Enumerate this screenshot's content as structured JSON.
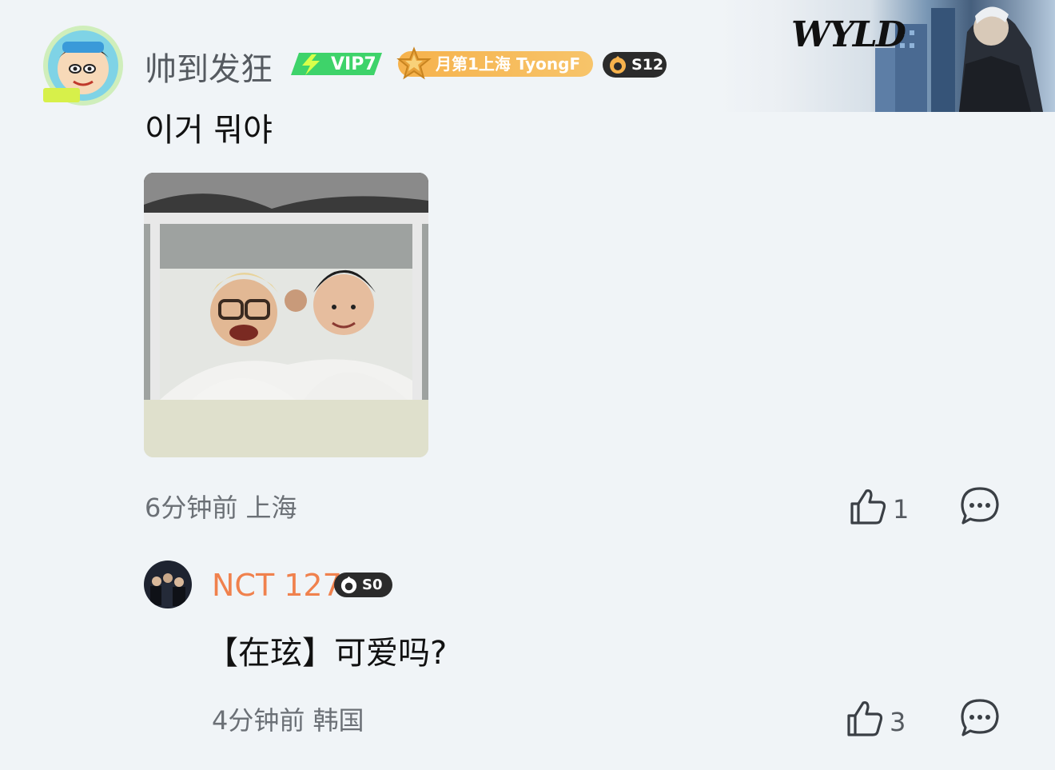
{
  "main_comment": {
    "username": "帅到发狂",
    "vip_badge": "VIP7",
    "rank_badge": "月第1上海 TyongF",
    "season_badge": "S12",
    "text": "이거 뭐야",
    "time": "6分钟前",
    "location": "上海",
    "like_count": "1"
  },
  "reply": {
    "username": "NCT 127",
    "season_badge": "S0",
    "text": "【在玹】可爱吗?",
    "time": "4分钟前",
    "location": "韩国",
    "like_count": "3"
  },
  "banner": {
    "logo_text": "WYLD"
  },
  "colors": {
    "background": "#f0f4f7",
    "reply_username": "#f0814d",
    "vip_green": "#3ed36a",
    "rank_orange": "#f6b24c",
    "badge_dark": "#2b2b2b"
  },
  "icons": {
    "like": "thumbs-up-icon",
    "reply": "chat-bubble-icon",
    "vip": "lightning-icon",
    "rank": "star-icon",
    "season": "flame-icon"
  }
}
